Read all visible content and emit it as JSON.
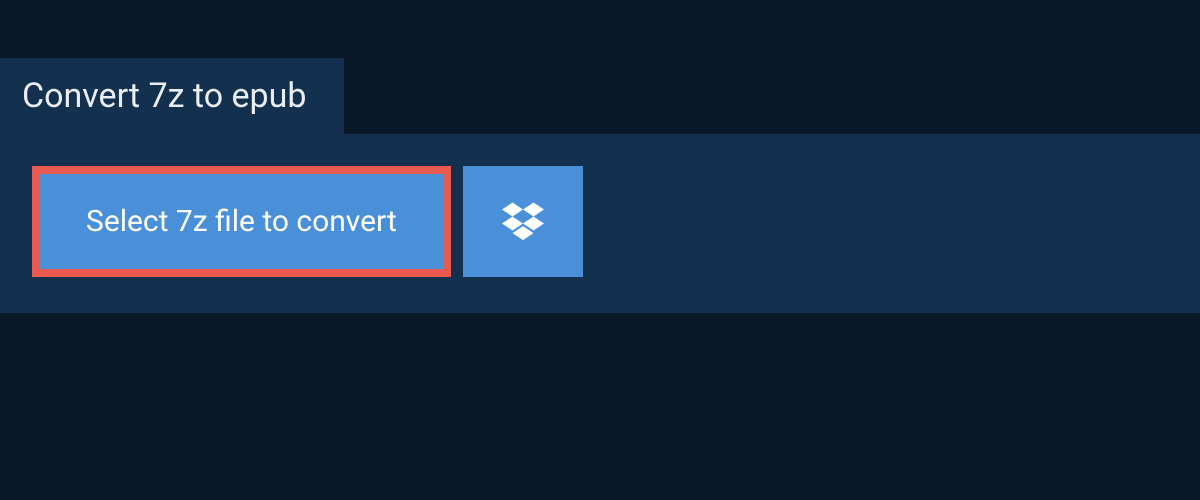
{
  "header": {
    "title": "Convert 7z to epub"
  },
  "actions": {
    "select_file_label": "Select 7z file to convert",
    "dropbox_icon": "dropbox-icon"
  }
}
